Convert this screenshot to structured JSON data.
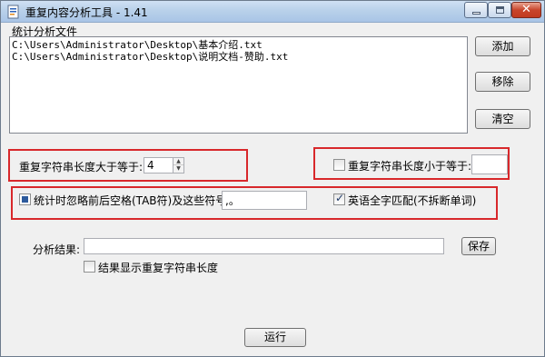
{
  "window": {
    "title": "重复内容分析工具 - 1.41",
    "close_glyph": "✕"
  },
  "files_group": {
    "label": "统计分析文件",
    "items": [
      "C:\\Users\\Administrator\\Desktop\\基本介绍.txt",
      "C:\\Users\\Administrator\\Desktop\\说明文档-赞助.txt"
    ],
    "add_label": "添加",
    "remove_label": "移除",
    "clear_label": "清空"
  },
  "options": {
    "min_length_label": "重复字符串长度大于等于:",
    "min_length_value": "4",
    "max_length_label": "重复字符串长度小于等于:",
    "max_length_checked": false,
    "max_length_value": "",
    "ignore_label": "统计时忽略前后空格(TAB符)及这些符号:",
    "ignore_checked": true,
    "ignore_symbols": ",。",
    "english_label": "英语全字匹配(不拆断单词)",
    "english_checked": true
  },
  "result": {
    "label": "分析结果:",
    "value": "",
    "save_label": "保存",
    "show_length_label": "结果显示重复字符串长度",
    "show_length_checked": false
  },
  "run_label": "运行",
  "colors": {
    "highlight": "#d8282b",
    "titlebar": "#b9d1ea"
  }
}
